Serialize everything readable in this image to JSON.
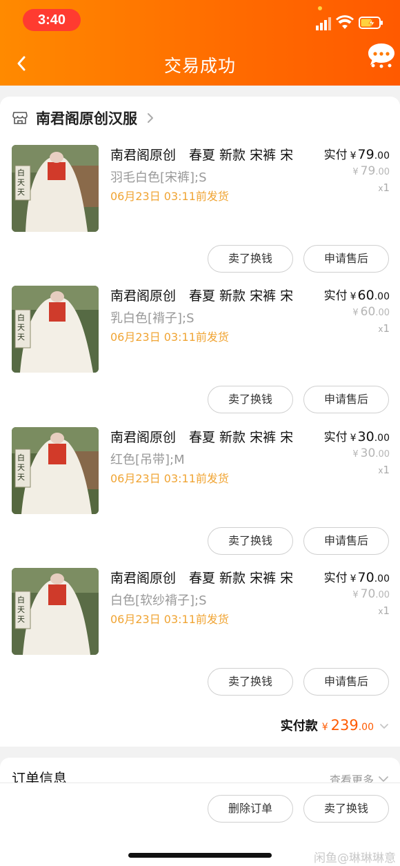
{
  "status_bar": {
    "time": "3:40"
  },
  "nav": {
    "title": "交易成功"
  },
  "shop": {
    "name": "南君阁原创汉服"
  },
  "items": [
    {
      "title": "南君阁原创　春夏  新款 宋裤 宋",
      "spec": "羽毛白色[宋裤];S",
      "ship": "06月23日 03:11前发货",
      "paid_label": "实付",
      "currency": "¥",
      "paid_int": "79",
      "paid_dec": ".00",
      "orig_int": "79",
      "orig_dec": ".00",
      "qty_x": "x",
      "qty": "1",
      "thumb_text": "白天天",
      "sell_btn": "卖了换钱",
      "after_btn": "申请售后"
    },
    {
      "title": "南君阁原创　春夏  新款 宋裤 宋",
      "spec": "乳白色[褙子];S",
      "ship": "06月23日 03:11前发货",
      "paid_label": "实付",
      "currency": "¥",
      "paid_int": "60",
      "paid_dec": ".00",
      "orig_int": "60",
      "orig_dec": ".00",
      "qty_x": "x",
      "qty": "1",
      "thumb_text": "白天天",
      "sell_btn": "卖了换钱",
      "after_btn": "申请售后"
    },
    {
      "title": "南君阁原创　春夏  新款 宋裤 宋",
      "spec": "红色[吊带];M",
      "ship": "06月23日 03:11前发货",
      "paid_label": "实付",
      "currency": "¥",
      "paid_int": "30",
      "paid_dec": ".00",
      "orig_int": "30",
      "orig_dec": ".00",
      "qty_x": "x",
      "qty": "1",
      "thumb_text": "白天天",
      "sell_btn": "卖了换钱",
      "after_btn": "申请售后"
    },
    {
      "title": "南君阁原创　春夏  新款 宋裤 宋",
      "spec": "白色[软纱褙子];S",
      "ship": "06月23日 03:11前发货",
      "paid_label": "实付",
      "currency": "¥",
      "paid_int": "70",
      "paid_dec": ".00",
      "orig_int": "70",
      "orig_dec": ".00",
      "qty_x": "x",
      "qty": "1",
      "thumb_text": "白天天",
      "sell_btn": "卖了换钱",
      "after_btn": "申请售后"
    }
  ],
  "total": {
    "label": "实付款",
    "currency": "¥",
    "int": "239",
    "dec": ".00"
  },
  "order_info": {
    "title": "订单信息",
    "more": "查看更多"
  },
  "bottom": {
    "delete_btn": "删除订单",
    "sell_btn": "卖了换钱"
  },
  "watermark": "闲鱼@琳琳琳意",
  "colors": {
    "accent": "#ff6a00",
    "ship": "#f0a433",
    "price": "#ff5a00"
  }
}
